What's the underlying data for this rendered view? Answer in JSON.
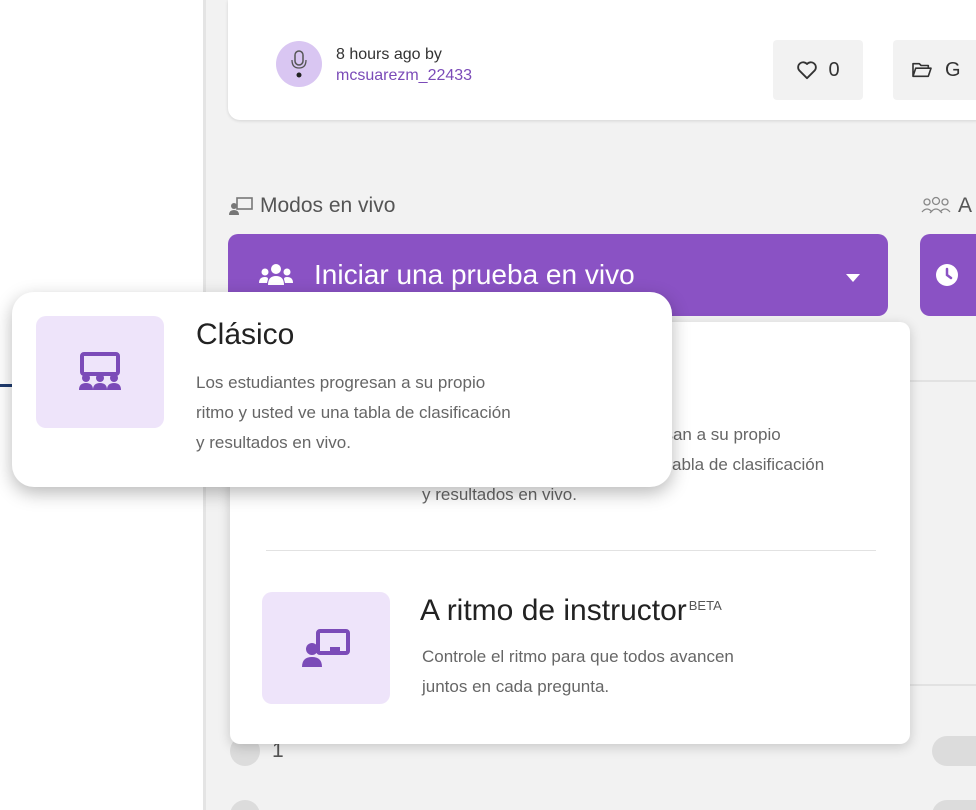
{
  "author": {
    "time": "8 hours ago by",
    "username": "mcsuarezm_22433"
  },
  "actions": {
    "likes_count": "0",
    "save_label_partial": "G"
  },
  "sections": {
    "live_modes_label": "Modos en vivo",
    "assign_label_partial": "A"
  },
  "live_button": {
    "label": "Iniciar una prueba en vivo"
  },
  "dropdown": {
    "items": [
      {
        "title": "Clásico",
        "desc_line1": "Los estudiantes progresan a su propio",
        "desc_line2": "ritmo y usted ve una tabla de clasificación",
        "desc_line3": "y resultados en vivo."
      },
      {
        "title": "A ritmo de instructor",
        "badge": "BETA",
        "desc_line1": "Controle el ritmo para que todos avancen",
        "desc_line2": "juntos en cada pregunta."
      }
    ],
    "partial_behind": {
      "line1": "esan a su propio",
      "line2": "abla de clasificación",
      "line3": "y resultados en vivo."
    }
  },
  "list": {
    "first_number": "1"
  },
  "colors": {
    "primary": "#8a52c4",
    "icon_bg": "#eee4fa",
    "link": "#7b4bb8"
  }
}
